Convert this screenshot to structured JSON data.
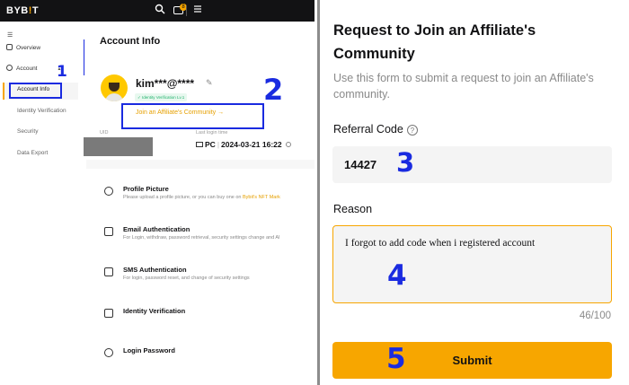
{
  "left_panel": {
    "topbar": {
      "logo_text": "BYB",
      "logo_dot": "!",
      "logo_end": "T",
      "notification_count": "8"
    },
    "sidebar": {
      "overview": "Overview",
      "account": "Account",
      "account_info": "Account Info",
      "identity_verification": "Identity Verification",
      "security": "Security",
      "data_export": "Data Export"
    },
    "main": {
      "title": "Account Info",
      "username": "kim***@****",
      "verification_badge": "Identity Verification Lv.1",
      "join_link": "Join an Affiliate's Community →",
      "uid_label": "UID",
      "last_login_label": "Last login time",
      "device": "PC",
      "last_login_time": "2024-03-21 16:22",
      "rows": [
        {
          "title": "Profile Picture",
          "desc": "Please upload a profile picture, or you can buy one on ",
          "desc_link": "Bybit's NFT Mark"
        },
        {
          "title": "Email Authentication",
          "desc": "For Login, withdraw, password retrieval, security settings change and AI"
        },
        {
          "title": "SMS Authentication",
          "desc": "For login, password reset, and change of security settings"
        },
        {
          "title": "Identity Verification",
          "desc": ""
        },
        {
          "title": "Login Password",
          "desc": ""
        }
      ]
    },
    "annotations": {
      "n1": "1",
      "n2": "2"
    }
  },
  "right_panel": {
    "title": "Request to Join an Affiliate's Community",
    "description": "Use this form to submit a request to join an Affiliate's community.",
    "referral_label": "Referral Code",
    "referral_value": "14427",
    "reason_label": "Reason",
    "reason_value": "I forgot to add code when i registered account",
    "counter": "46/100",
    "submit_label": "Submit",
    "annotations": {
      "n3": "3",
      "n4": "4",
      "n5": "5"
    }
  },
  "colors": {
    "accent": "#f7a600",
    "annotation_blue": "#1a2be0",
    "verified_green": "#20b26c"
  }
}
